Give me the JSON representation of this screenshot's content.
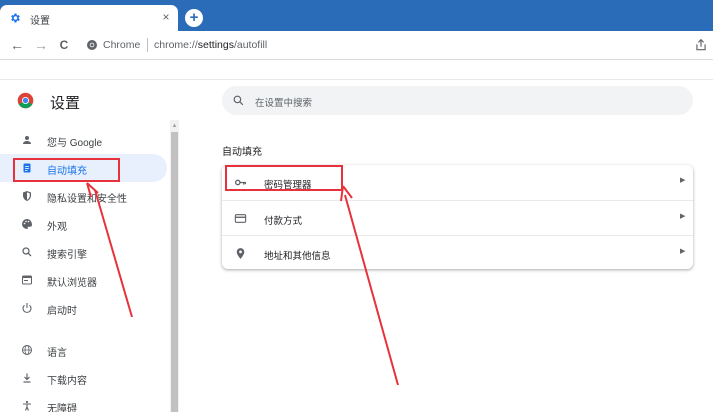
{
  "tab": {
    "title": "设置",
    "icon": "gear-icon"
  },
  "toolbar": {
    "back": "←",
    "forward": "→",
    "reload": "C",
    "site_name": "Chrome",
    "url_prefix": "chrome://",
    "url_path": "settings",
    "url_suffix": "/autofill"
  },
  "page": {
    "title": "设置"
  },
  "sidebar": {
    "items": [
      {
        "label": "您与 Google",
        "icon": "person-icon"
      },
      {
        "label": "自动填充",
        "icon": "clipboard-icon",
        "active": true
      },
      {
        "label": "隐私设置和安全性",
        "icon": "shield-icon"
      },
      {
        "label": "外观",
        "icon": "palette-icon"
      },
      {
        "label": "搜索引擎",
        "icon": "search-icon"
      },
      {
        "label": "默认浏览器",
        "icon": "browser-icon"
      },
      {
        "label": "启动时",
        "icon": "power-icon"
      },
      {
        "label": "语言",
        "icon": "globe-icon"
      },
      {
        "label": "下载内容",
        "icon": "download-icon"
      },
      {
        "label": "无障碍",
        "icon": "accessibility-icon"
      }
    ]
  },
  "search": {
    "placeholder": "在设置中搜索"
  },
  "section": {
    "title": "自动填充"
  },
  "autofill_rows": [
    {
      "label": "密码管理器",
      "icon": "key-icon"
    },
    {
      "label": "付款方式",
      "icon": "credit-card-icon"
    },
    {
      "label": "地址和其他信息",
      "icon": "location-pin-icon"
    }
  ],
  "colors": {
    "accent": "#1a73e8",
    "annotation": "#e8323b",
    "tabstrip": "#2b6cb8"
  }
}
